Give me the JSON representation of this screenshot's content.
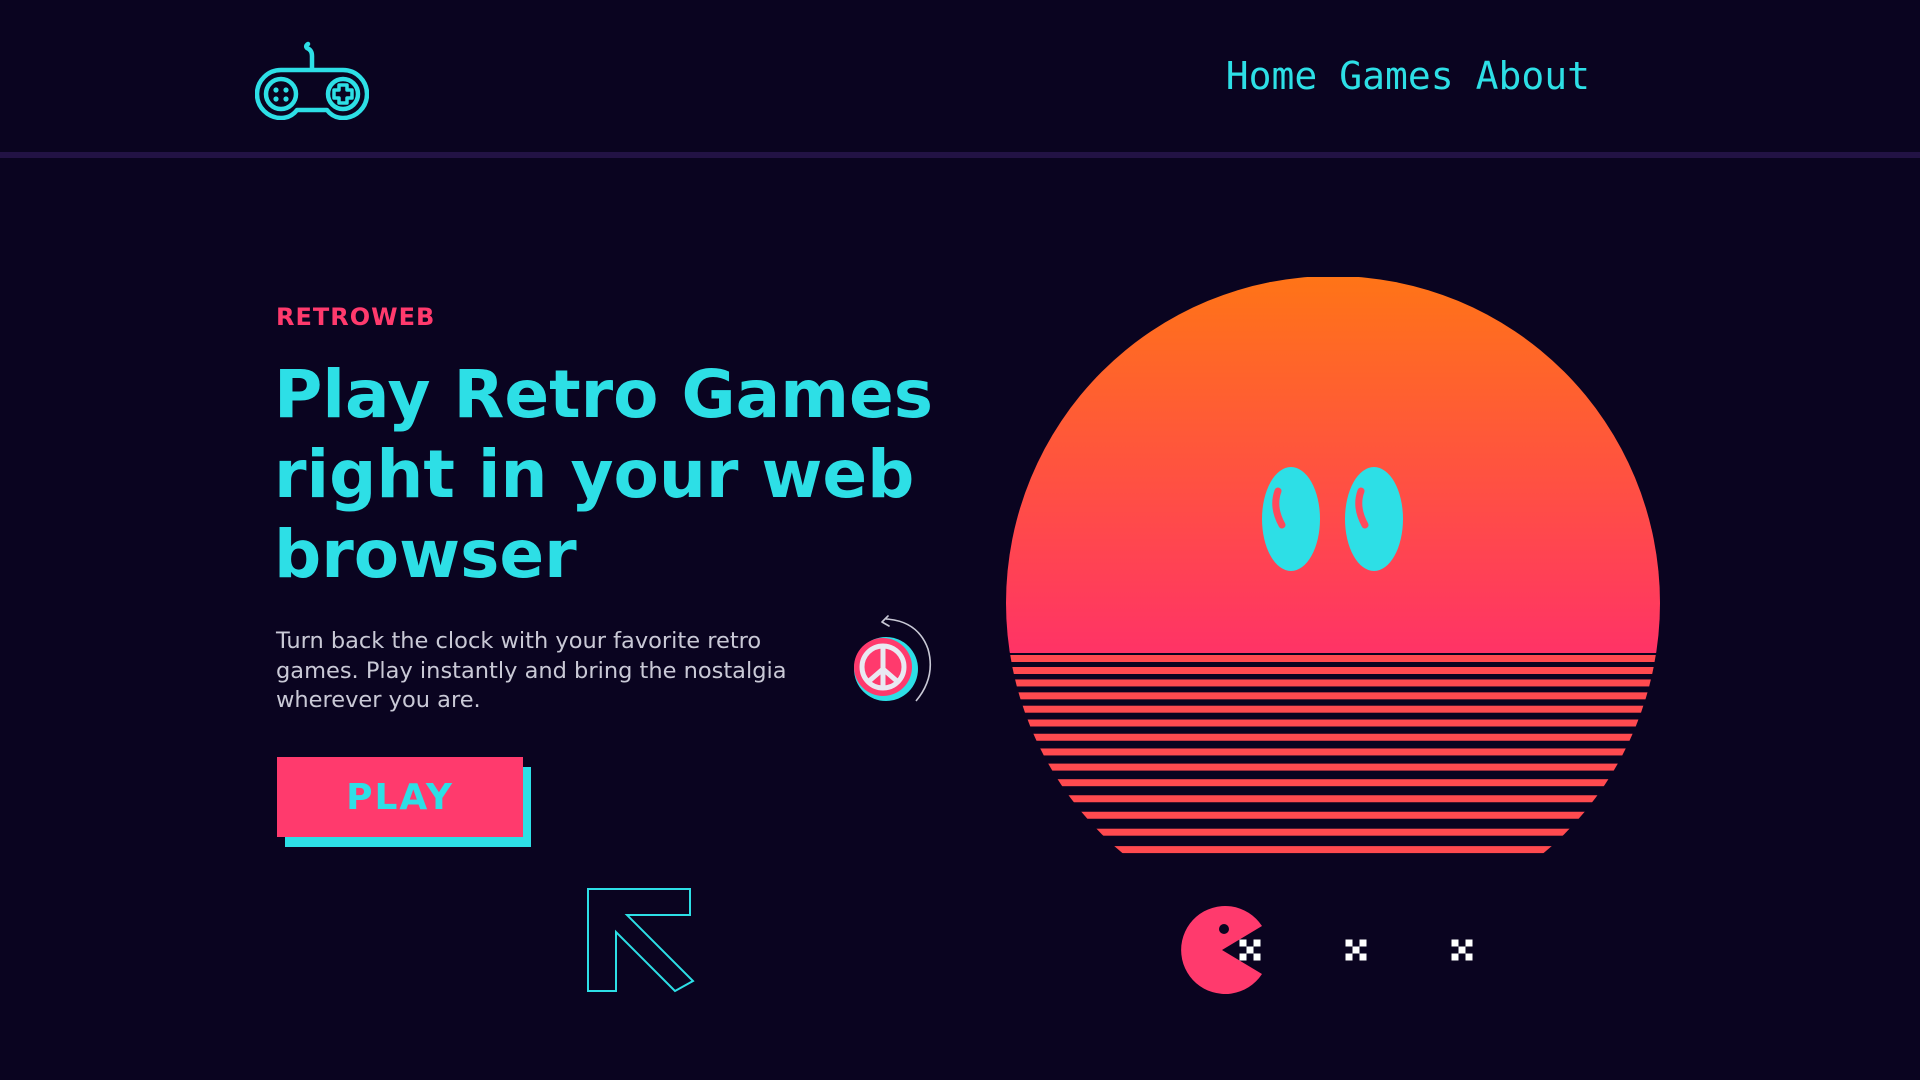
{
  "nav": {
    "items": [
      {
        "label": "Home"
      },
      {
        "label": "Games"
      },
      {
        "label": "About"
      }
    ]
  },
  "hero": {
    "eyebrow": "RETROWEB",
    "headline": "Play Retro Games right in your web browser",
    "description": "Turn back the clock with your favorite retro games. Play instantly and bring the nostalgia wherever you are.",
    "cta_label": "PLAY"
  },
  "icons": {
    "logo": "gamepad-icon",
    "peace": "peace-sign-icon",
    "arrow": "arrow-up-left-icon",
    "sun": "retro-sun-with-eyes",
    "pacman": "pacman-icon"
  },
  "colors": {
    "background": "#0a0420",
    "accent_cyan": "#2ddfe6",
    "accent_pink": "#ff3a6d",
    "sun_top": "#ff7417",
    "sun_bottom": "#ff3366"
  }
}
